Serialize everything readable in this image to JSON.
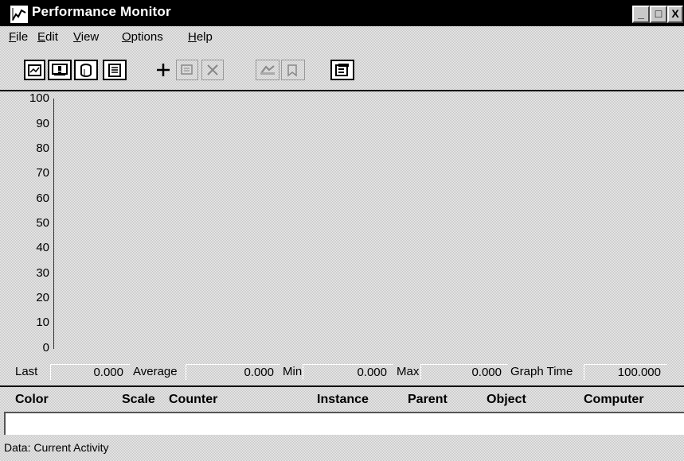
{
  "window": {
    "title": "Performance Monitor"
  },
  "title_buttons": {
    "minimize": "_",
    "maximize": "□",
    "close": "X"
  },
  "menu": [
    {
      "mnemonic": "F",
      "rest": "ile"
    },
    {
      "mnemonic": "E",
      "rest": "dit"
    },
    {
      "mnemonic": "V",
      "rest": "iew"
    },
    {
      "mnemonic": "O",
      "rest": "ptions"
    },
    {
      "mnemonic": "H",
      "rest": "elp"
    }
  ],
  "toolbar": {
    "buttons": [
      "chart-view-icon",
      "alert-view-icon",
      "log-view-icon",
      "report-view-icon",
      "add-counter-icon",
      "edit-counter-icon",
      "delete-counter-icon",
      "update-now-icon",
      "bookmark-icon",
      "options-icon"
    ]
  },
  "graph": {
    "y_ticks": [
      "100",
      "90",
      "80",
      "70",
      "60",
      "50",
      "40",
      "30",
      "20",
      "10",
      "0"
    ],
    "ylim": [
      0,
      100
    ]
  },
  "stats": {
    "last_label": "Last",
    "last_value": "0.000",
    "average_label": "Average",
    "average_value": "0.000",
    "min_label": "Min",
    "min_value": "0.000",
    "max_label": "Max",
    "max_value": "0.000",
    "graph_time_label": "Graph Time",
    "graph_time_value": "100.000"
  },
  "legend": {
    "columns": [
      "Color",
      "Scale",
      "Counter",
      "Instance",
      "Parent",
      "Object",
      "Computer"
    ]
  },
  "status": {
    "text": "Data: Current Activity"
  }
}
